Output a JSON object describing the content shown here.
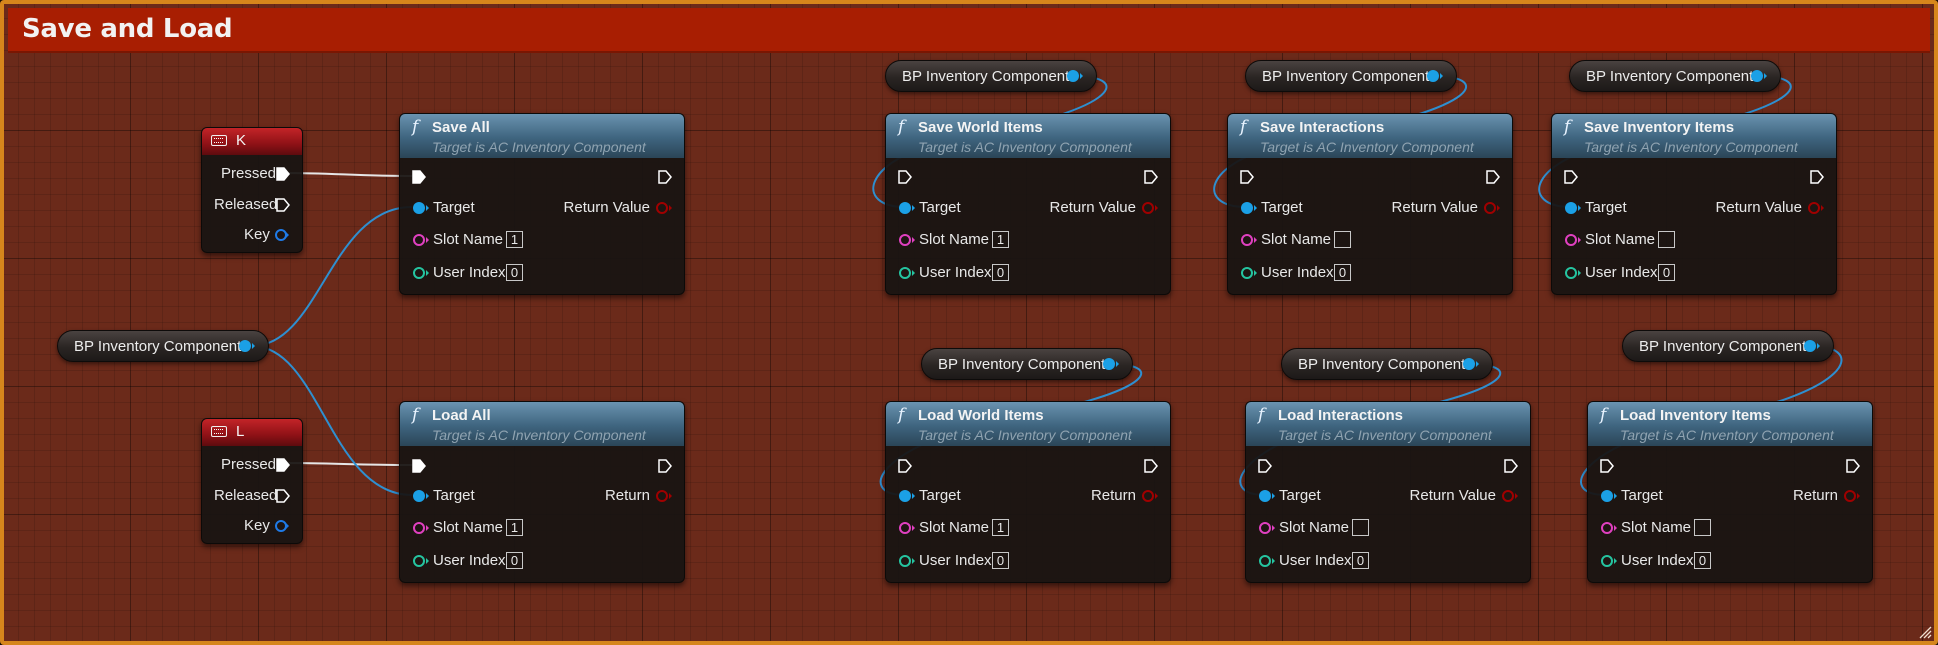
{
  "comment": {
    "title": "Save and Load",
    "border_color": "#d6861c",
    "header_color": "#a81e02",
    "body_color": "#6b2a1a"
  },
  "pin_colors": {
    "exec": "#ffffff",
    "object": "#1ba0e6",
    "string": "#e040c0",
    "int": "#25c4a0",
    "bool": "#a00000",
    "struct": "#1f7ae6"
  },
  "common": {
    "target": "Target",
    "return_value": "Return Value",
    "return": "Return",
    "slot_name": "Slot Name",
    "user_index": "User Index",
    "target_sub": "Target is AC Inventory Component",
    "var_label": "BP Inventory Component",
    "pressed": "Pressed",
    "released": "Released",
    "key": "Key",
    "func_glyph": "f"
  },
  "events": [
    {
      "key": "K"
    },
    {
      "key": "L"
    }
  ],
  "functions": [
    {
      "title": "Save All",
      "return_label": "Return Value",
      "slot_value": "1",
      "index_value": "0"
    },
    {
      "title": "Load All",
      "return_label": "Return",
      "slot_value": "1",
      "index_value": "0"
    },
    {
      "title": "Save World Items",
      "return_label": "Return Value",
      "slot_value": "1",
      "index_value": "0"
    },
    {
      "title": "Save Interactions",
      "return_label": "Return Value",
      "slot_value": "",
      "index_value": "0"
    },
    {
      "title": "Save Inventory Items",
      "return_label": "Return Value",
      "slot_value": "",
      "index_value": "0"
    },
    {
      "title": "Load World Items",
      "return_label": "Return",
      "slot_value": "1",
      "index_value": "0"
    },
    {
      "title": "Load Interactions",
      "return_label": "Return Value",
      "slot_value": "",
      "index_value": "0"
    },
    {
      "title": "Load Inventory Items",
      "return_label": "Return",
      "slot_value": "",
      "index_value": "0"
    }
  ]
}
